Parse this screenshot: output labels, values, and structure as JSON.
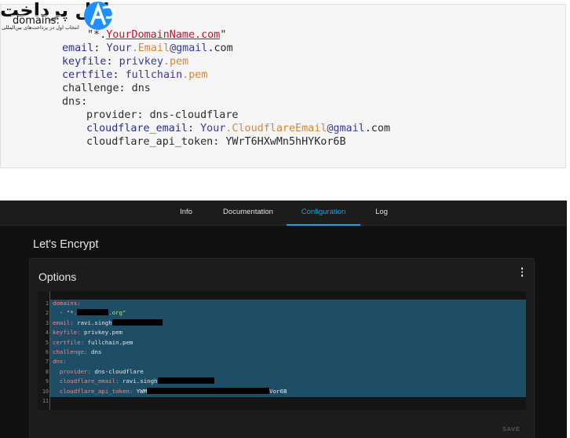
{
  "snippet": {
    "line_domain": {
      "pre": "\"*.",
      "highlight": "YourDomainName.com",
      "post": "\""
    },
    "email": {
      "key": "email",
      "p1": "Your",
      "p2": ".Email",
      "p3": "@gmail",
      "p4": ".com"
    },
    "keyfile": {
      "key": "keyfile",
      "p1": "privkey",
      "p2": ".pem"
    },
    "certfile": {
      "key": "certfile",
      "p1": "fullchain",
      "p2": ".pem"
    },
    "challenge": "challenge: dns",
    "dns_key": "dns:",
    "provider": "provider: dns-cloudflare",
    "cf_email": {
      "key": "cloudflare_email",
      "p1": "Your",
      "p2": ".CloudflareEmail",
      "p3": "@gmail",
      "p4": ".com"
    },
    "cf_token": "cloudflare_api_token: YWrT6HXwMn5hHYKor6B"
  },
  "watermark": {
    "brand": "اول پرداخت",
    "sub": "domains:",
    "tagline": "انتخاب اول در پرداخت‌های بین‌المللی"
  },
  "app": {
    "tabs": [
      "Info",
      "Documentation",
      "Configuration",
      "Log"
    ],
    "active_tab": "Configuration",
    "page_title": "Let's Encrypt",
    "card_title": "Options",
    "save_label": "SAVE",
    "editor": {
      "line_numbers": [
        "1",
        "2",
        "3",
        "4",
        "5",
        "6",
        "7",
        "8",
        "9",
        "10",
        "11"
      ],
      "l1": "domains:",
      "l2_a": "  - \"*.",
      "l2_b": ".org\"",
      "l3_k": "email:",
      "l3_v": " ravi.singh",
      "l4_k": "keyfile:",
      "l4_v": " privkey.pem",
      "l5_k": "certfile:",
      "l5_v": " fullchain.pem",
      "l6_k": "challenge:",
      "l6_v": " dns",
      "l7": "dns:",
      "l8_k": "  provider:",
      "l8_v": " dns-cloudflare",
      "l9_k": "  cloudflare_email:",
      "l9_v": " ravi.singh",
      "l10_k": "  cloudflare_api_token:",
      "l10_a": " YWM",
      "l10_b": "Vor6B"
    },
    "colors": {
      "accent": "#03a9f4",
      "selection": "#1e4d66",
      "key": "#e68a8f",
      "string": "#b5dd8a"
    }
  }
}
